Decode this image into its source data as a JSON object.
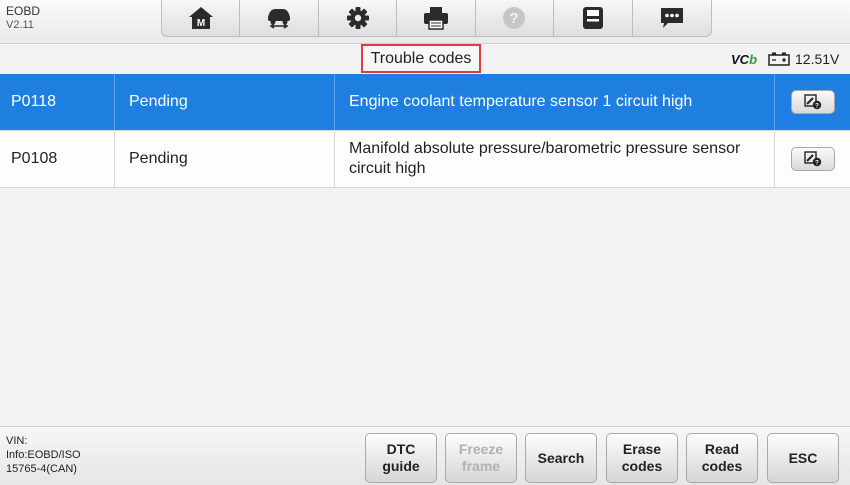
{
  "app": {
    "name": "EOBD",
    "version": "V2.11"
  },
  "toolbar": {
    "items": [
      {
        "icon": "home-icon",
        "glyph": "M"
      },
      {
        "icon": "vehicle-swap-icon"
      },
      {
        "icon": "settings-gear-icon"
      },
      {
        "icon": "print-icon"
      },
      {
        "icon": "help-icon"
      },
      {
        "icon": "save-icon"
      },
      {
        "icon": "message-icon"
      }
    ]
  },
  "status": {
    "title": "Trouble codes",
    "vci_prefix": "VC",
    "vci_suffix": "b",
    "voltage": "12.51V"
  },
  "codes": [
    {
      "code": "P0118",
      "status": "Pending",
      "description": "Engine coolant temperature sensor 1 circuit high",
      "selected": true
    },
    {
      "code": "P0108",
      "status": "Pending",
      "description": "Manifold absolute pressure/barometric pressure sensor circuit high",
      "selected": false
    }
  ],
  "bottom": {
    "vin_label": "VIN:",
    "info_line1": "Info:EOBD/ISO",
    "info_line2": "15765-4(CAN)",
    "buttons": {
      "dtc_guide": "DTC\nguide",
      "freeze_frame": "Freeze\nframe",
      "search": "Search",
      "erase_codes": "Erase\ncodes",
      "read_codes": "Read\ncodes",
      "esc": "ESC"
    }
  },
  "colors": {
    "selected_row": "#1e7fe0",
    "highlight_border": "#e23b3b",
    "vci_accent": "#2e9e2e"
  }
}
